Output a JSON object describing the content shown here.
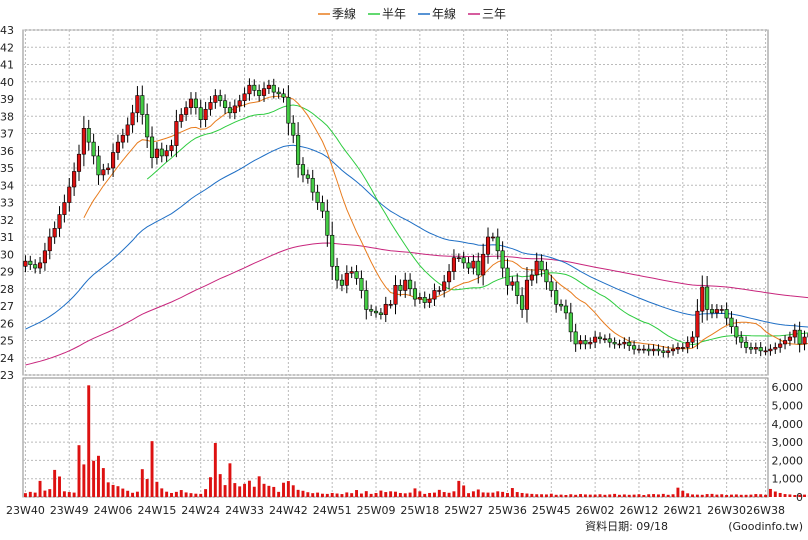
{
  "chart_data": {
    "type": "candlestick",
    "legend": [
      {
        "name": "季線",
        "color": "#e87c1e"
      },
      {
        "name": "半年",
        "color": "#2ecc40"
      },
      {
        "name": "年線",
        "color": "#1f6fc5"
      },
      {
        "name": "三年",
        "color": "#c8267d"
      }
    ],
    "price_axis": {
      "min": 23,
      "max": 43,
      "ticks": [
        23,
        24,
        25,
        26,
        27,
        28,
        29,
        30,
        31,
        32,
        33,
        34,
        35,
        36,
        37,
        38,
        39,
        40,
        41,
        42,
        43
      ]
    },
    "volume_axis": {
      "min": 0,
      "max": 6500,
      "ticks": [
        "0",
        "1,000",
        "2,000",
        "3,000",
        "4,000",
        "5,000",
        "6,000"
      ],
      "tick_values": [
        0,
        1000,
        2000,
        3000,
        4000,
        5000,
        6000
      ]
    },
    "x_labels": [
      "23W40",
      "23W49",
      "24W06",
      "24W15",
      "24W24",
      "24W33",
      "24W42",
      "24W51",
      "25W09",
      "25W18",
      "25W27",
      "25W36",
      "25W45",
      "26W02",
      "26W12",
      "26W21",
      "26W30",
      "26W38"
    ],
    "x_label_index": [
      0,
      9,
      18,
      27,
      36,
      45,
      54,
      63,
      72,
      81,
      90,
      99,
      108,
      117,
      126,
      135,
      144,
      152
    ],
    "num_weeks": 153,
    "close": [
      29.6,
      29.4,
      29.2,
      29.5,
      30.2,
      31.0,
      31.5,
      32.3,
      33.0,
      33.9,
      34.8,
      35.8,
      37.3,
      36.5,
      35.7,
      34.6,
      34.9,
      35.0,
      35.9,
      36.5,
      36.9,
      37.5,
      38.2,
      39.2,
      38.1,
      36.8,
      35.6,
      36.1,
      35.7,
      36.0,
      36.3,
      37.7,
      38.1,
      38.5,
      39.0,
      38.5,
      37.8,
      38.4,
      38.8,
      39.2,
      38.9,
      38.5,
      38.2,
      38.6,
      38.9,
      39.3,
      39.8,
      39.5,
      39.2,
      39.6,
      39.8,
      39.4,
      39.3,
      39.1,
      37.6,
      36.9,
      35.2,
      34.6,
      34.4,
      33.6,
      33.0,
      32.5,
      31.1,
      29.3,
      28.5,
      28.2,
      28.9,
      29.0,
      28.6,
      27.9,
      26.8,
      26.7,
      26.6,
      26.5,
      27.1,
      27.1,
      28.2,
      27.9,
      28.5,
      28.0,
      27.4,
      27.5,
      27.2,
      27.4,
      27.9,
      27.9,
      28.4,
      29.0,
      29.8,
      29.8,
      29.5,
      29.2,
      29.6,
      28.8,
      30.0,
      31.0,
      31.0,
      30.2,
      29.2,
      28.2,
      28.4,
      27.6,
      26.8,
      28.5,
      28.8,
      29.6,
      29.1,
      28.4,
      27.9,
      27.1,
      27.0,
      26.6,
      25.5,
      24.8,
      25.0,
      24.8,
      24.9,
      25.2,
      25.1,
      25.1,
      24.9,
      24.8,
      24.8,
      24.9,
      24.7,
      24.5,
      24.5,
      24.5,
      24.4,
      24.5,
      24.4,
      24.3,
      24.4,
      24.5,
      24.6,
      24.6,
      24.9,
      25.2,
      26.7,
      28.1,
      26.8,
      26.6,
      26.8,
      26.8,
      26.3,
      25.8,
      25.2,
      24.9,
      24.6,
      24.5,
      24.6,
      24.4,
      24.4,
      24.5,
      24.6,
      24.8,
      25.0,
      25.2,
      25.6,
      24.8,
      25.2,
      25.4,
      24.7,
      24.4,
      24.9,
      24.6,
      24.4,
      24.3,
      24.1,
      23.9,
      24.4
    ],
    "volume": [
      210,
      280,
      240,
      880,
      350,
      430,
      1480,
      1120,
      310,
      270,
      240,
      2830,
      1780,
      6100,
      1980,
      2250,
      1580,
      800,
      660,
      590,
      460,
      340,
      230,
      290,
      1520,
      980,
      3050,
      830,
      470,
      290,
      220,
      280,
      380,
      250,
      210,
      180,
      170,
      430,
      1080,
      2950,
      1250,
      650,
      1840,
      760,
      580,
      720,
      890,
      560,
      1130,
      720,
      610,
      550,
      280,
      780,
      870,
      640,
      390,
      340,
      260,
      210,
      240,
      180,
      170,
      220,
      190,
      160,
      250,
      210,
      380,
      190,
      320,
      170,
      220,
      350,
      270,
      310,
      290,
      220,
      200,
      240,
      470,
      310,
      170,
      220,
      240,
      390,
      270,
      230,
      310,
      880,
      630,
      210,
      310,
      410,
      250,
      240,
      240,
      310,
      280,
      220,
      490,
      270,
      220,
      190,
      170,
      150,
      150,
      140,
      180,
      120,
      130,
      110,
      150,
      120,
      160,
      140,
      130,
      130,
      150,
      120,
      140,
      170,
      120,
      140,
      120,
      130,
      150,
      110,
      150,
      160,
      140,
      170,
      120,
      150,
      510,
      340,
      200,
      140,
      130,
      120,
      160,
      170,
      130,
      150,
      110,
      130,
      140,
      120,
      120,
      130,
      160,
      150,
      120,
      440,
      300,
      220,
      160,
      140,
      110,
      120,
      130,
      110,
      120
    ]
  },
  "footer": {
    "date_text": "資料日期: 09/18",
    "source_text": "(Goodinfo.tw)"
  }
}
